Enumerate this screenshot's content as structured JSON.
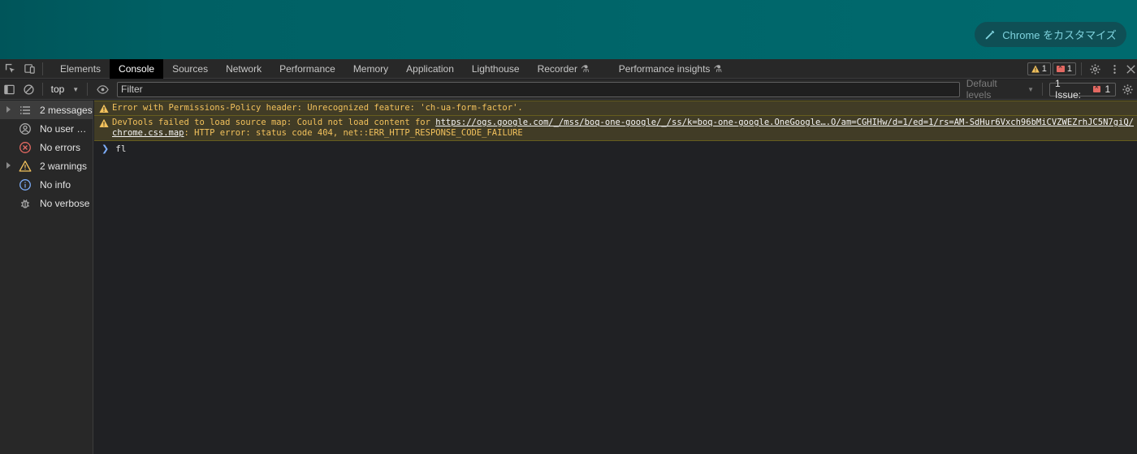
{
  "page": {
    "customize_label": "Chrome をカスタマイズ",
    "page_bg": "#006064"
  },
  "devtools": {
    "tabs": [
      {
        "label": "Elements",
        "active": false
      },
      {
        "label": "Console",
        "active": true
      },
      {
        "label": "Sources",
        "active": false
      },
      {
        "label": "Network",
        "active": false
      },
      {
        "label": "Performance",
        "active": false
      },
      {
        "label": "Memory",
        "active": false
      },
      {
        "label": "Application",
        "active": false
      },
      {
        "label": "Lighthouse",
        "active": false
      },
      {
        "label": "Recorder",
        "active": false,
        "experimental": true
      },
      {
        "label": "Performance insights",
        "active": false,
        "experimental": true
      }
    ],
    "warning_count": "1",
    "error_count": "1"
  },
  "toolbar": {
    "context": "top",
    "filter_placeholder": "Filter",
    "levels_label": "Default levels",
    "issues_label": "1 Issue:",
    "issues_count": "1"
  },
  "sidebar": {
    "items": [
      {
        "label": "2 messages",
        "icon": "list-icon",
        "expandable": true,
        "selected": true
      },
      {
        "label": "No user m...",
        "icon": "user-icon",
        "expandable": false,
        "selected": false
      },
      {
        "label": "No errors",
        "icon": "error-icon",
        "expandable": false,
        "selected": false
      },
      {
        "label": "2 warnings",
        "icon": "warning-icon",
        "expandable": true,
        "selected": false
      },
      {
        "label": "No info",
        "icon": "info-icon",
        "expandable": false,
        "selected": false
      },
      {
        "label": "No verbose",
        "icon": "bug-icon",
        "expandable": false,
        "selected": false
      }
    ]
  },
  "console": {
    "messages": [
      {
        "level": "warning",
        "text": "Error with Permissions-Policy header: Unrecognized feature: 'ch-ua-form-factor'."
      },
      {
        "level": "warning",
        "text_before": "DevTools failed to load source map: Could not load content for ",
        "link": "https://ogs.google.com/_/mss/boq-one-google/_/ss/k=boq-one-google.OneGoogle….O/am=CGHIHw/d=1/ed=1/rs=AM-SdHur6Vxch96bMiCVZWEZrhJC5N7giQ/chrome.css.map",
        "text_after": ": HTTP error: status code 404, net::ERR_HTTP_RESPONSE_CODE_FAILURE"
      }
    ],
    "input": "fl"
  },
  "colors": {
    "warning_text": "#f2c15c",
    "warning_bg": "#413c26",
    "error": "#e46962",
    "accent": "#7cacf8"
  }
}
